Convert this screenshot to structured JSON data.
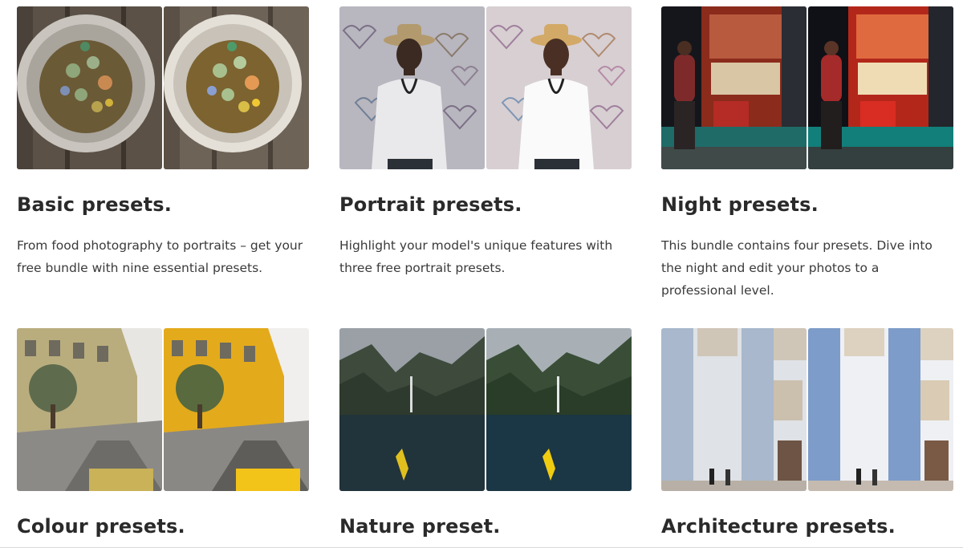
{
  "presets": [
    {
      "title": "Basic presets.",
      "description": "From food photography to portraits – get your free bundle with nine essential presets.",
      "photo_subject": "food bowl"
    },
    {
      "title": "Portrait presets.",
      "description": "Highlight your model's unique features with three free portrait presets.",
      "photo_subject": "portrait man with hat"
    },
    {
      "title": "Night presets.",
      "description": "This bundle contains four presets. Dive into the night and edit your photos to a professional level.",
      "photo_subject": "night street kiosk"
    },
    {
      "title": "Colour presets.",
      "description": "",
      "photo_subject": "city street"
    },
    {
      "title": "Nature preset.",
      "description": "",
      "photo_subject": "fjord with kayak"
    },
    {
      "title": "Architecture presets.",
      "description": "",
      "photo_subject": "tiled facade"
    }
  ]
}
